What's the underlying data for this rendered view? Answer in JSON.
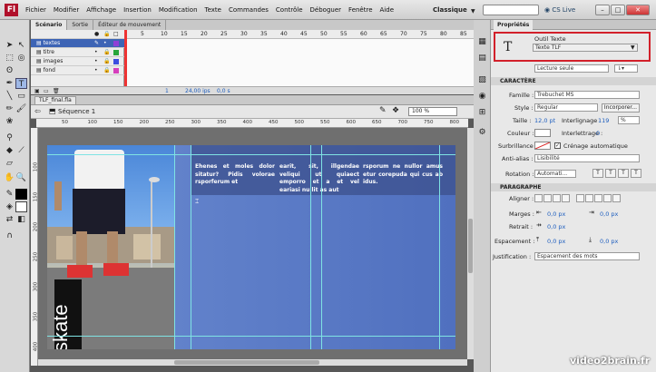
{
  "menubar": {
    "logo": "Fl",
    "items": [
      "Fichier",
      "Modifier",
      "Affichage",
      "Insertion",
      "Modification",
      "Texte",
      "Commandes",
      "Contrôle",
      "Déboguer",
      "Fenêtre",
      "Aide"
    ],
    "workspace": "Classique",
    "cslive": "CS Live"
  },
  "timeline": {
    "tabs": [
      "Scénario",
      "Sortie",
      "Éditeur de mouvement"
    ],
    "layers": [
      {
        "name": "textes",
        "color": "#8f3fd6",
        "selected": true
      },
      {
        "name": "titre",
        "color": "#27a63a",
        "selected": false
      },
      {
        "name": "images",
        "color": "#3b4ee0",
        "selected": false
      },
      {
        "name": "fond",
        "color": "#d63fbd",
        "selected": false
      }
    ],
    "frame_numbers": [
      "5",
      "10",
      "15",
      "20",
      "25",
      "30",
      "35",
      "40",
      "45",
      "50",
      "55",
      "60",
      "65",
      "70",
      "75",
      "80",
      "85"
    ],
    "current_frame": "1",
    "fps": "24,00 ips",
    "time": "0,0 s"
  },
  "document": {
    "tab": "TLF_final.fla",
    "scene": "Séquence 1",
    "zoom": "100 %",
    "ruler_h": [
      "50",
      "100",
      "150",
      "200",
      "250",
      "300",
      "350",
      "400",
      "450",
      "500",
      "550",
      "600",
      "650",
      "700",
      "750",
      "800"
    ],
    "ruler_v": [
      "100",
      "150",
      "200",
      "250",
      "300",
      "350",
      "400"
    ],
    "stage_title": "skate",
    "columns": [
      "Ehenes et moles dolor sitatur? Pidis volorae rsporferum et",
      "earit, sit, illgendae veliqui ut quiaect emporro et a et vel eariasi nullit as aut",
      "rsporum ne nullor amus etur corepuda qui cus ab idus."
    ]
  },
  "properties": {
    "tab": "Propriétés",
    "tool_label": "Outil Texte",
    "text_type": "Texte TLF",
    "reading": "Lecture seule",
    "character": {
      "section": "CARACTÈRE",
      "family_label": "Famille :",
      "family": "Trebuchet MS",
      "style_label": "Style :",
      "style": "Regular",
      "embed": "Incorporer...",
      "size_label": "Taille :",
      "size": "12,0 pt",
      "leading_label": "Interlignage :",
      "leading": "119",
      "leading_unit": "%",
      "color_label": "Couleur :",
      "tracking_label": "Interlettrage :",
      "tracking": "0",
      "highlight_label": "Surbrillance :",
      "autokern": "Crénage automatique",
      "antialias_label": "Anti-alias :",
      "antialias": "Lisibilité",
      "rotation_label": "Rotation :",
      "rotation": "Automati..."
    },
    "paragraph": {
      "section": "PARAGRAPHE",
      "align_label": "Aligner :",
      "margins_label": "Marges :",
      "margin_left": "0,0 px",
      "margin_right": "0,0 px",
      "indent_label": "Retrait :",
      "indent": "0,0 px",
      "spacing_label": "Espacement :",
      "space_before": "0,0 px",
      "space_after": "0,0 px",
      "justify_label": "Justification :",
      "justify": "Espacement des mots"
    }
  },
  "watermark": "video2brain.fr"
}
